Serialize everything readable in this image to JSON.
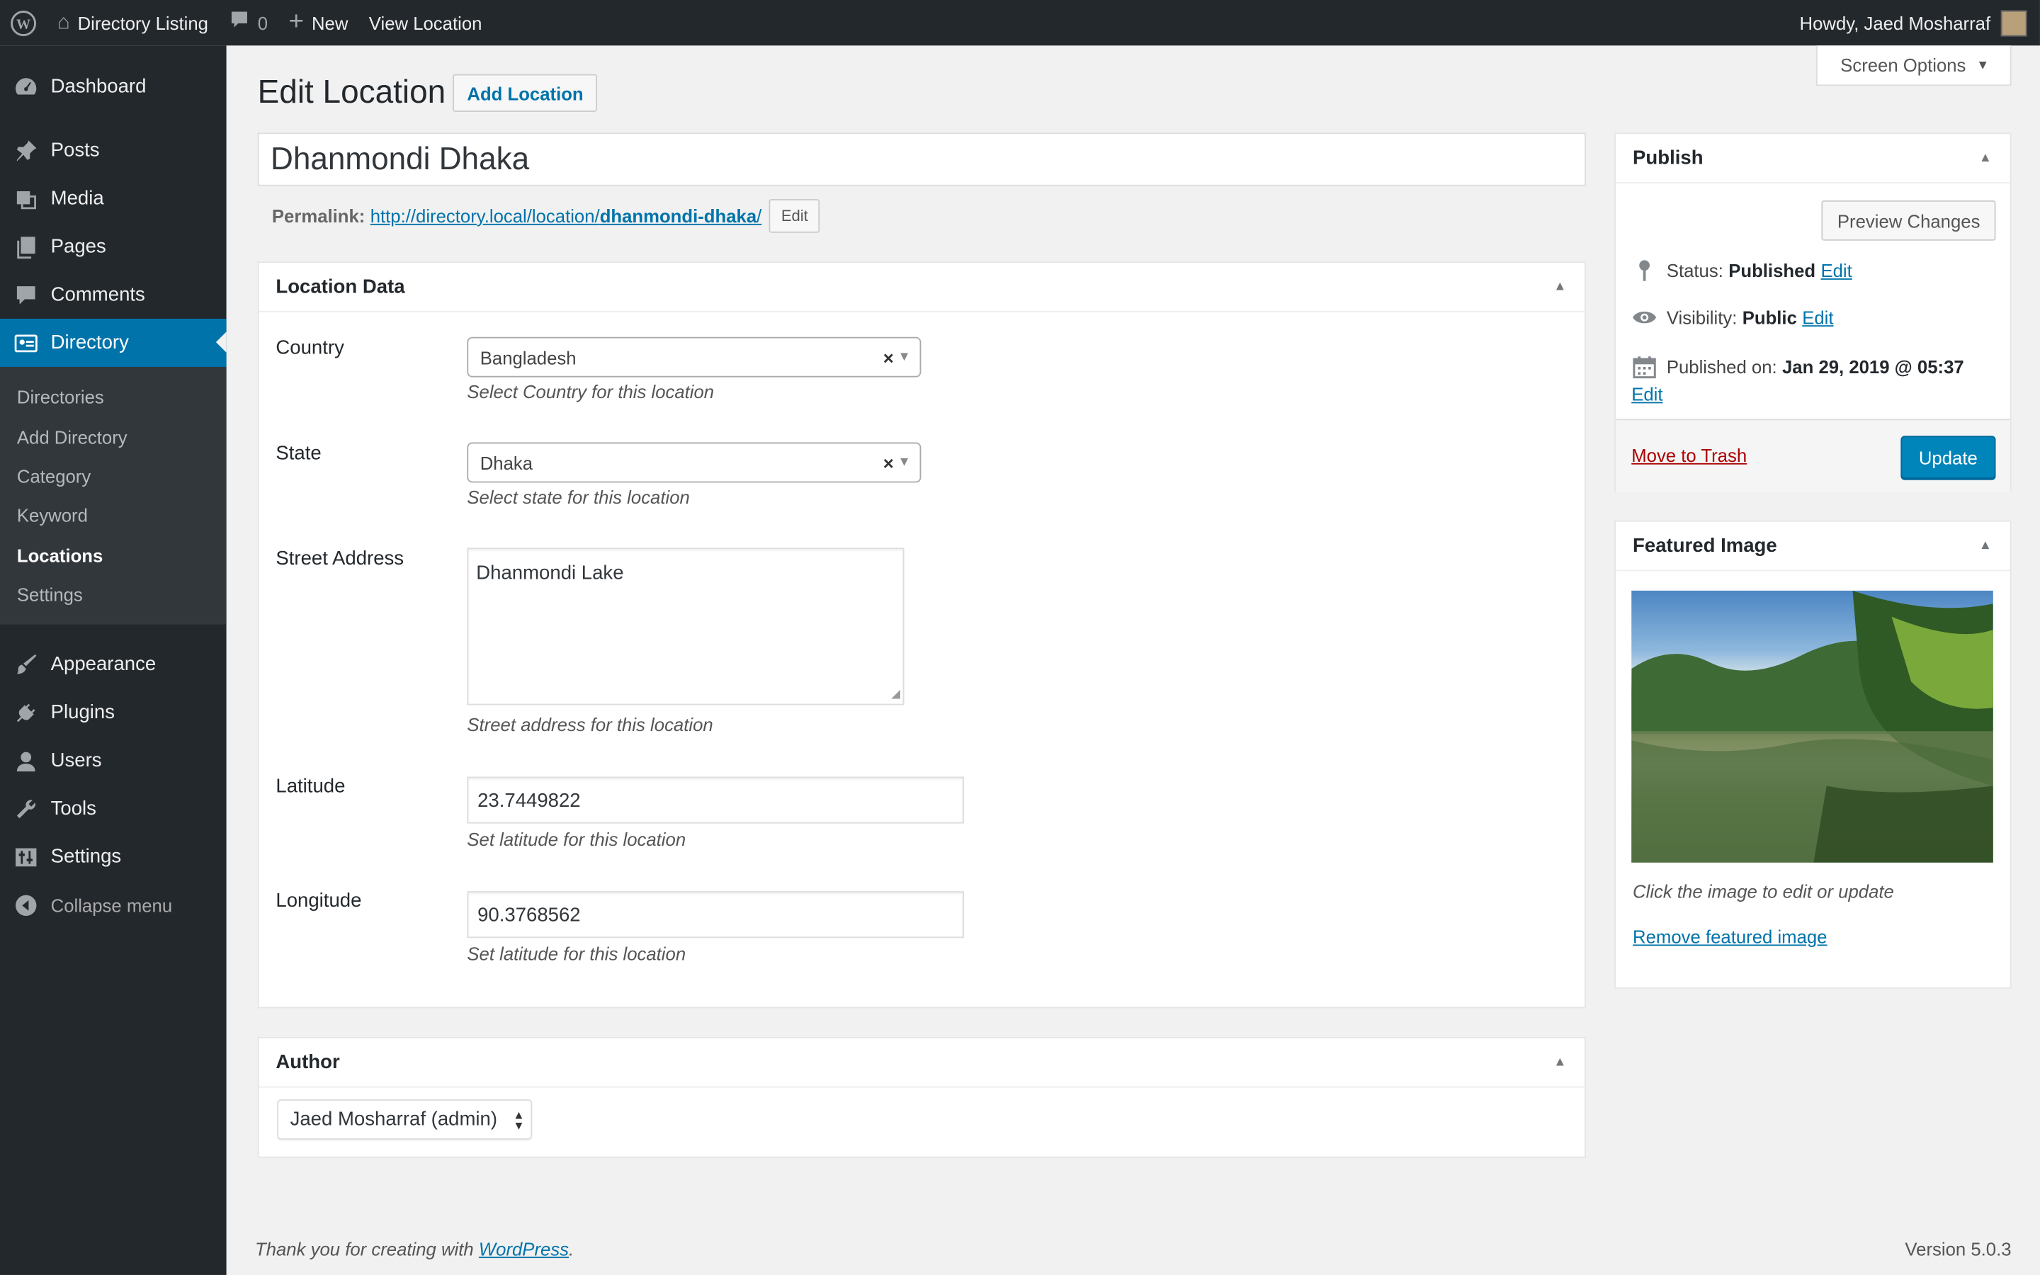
{
  "adminbar": {
    "site_name": "Directory Listing",
    "comments_count": "0",
    "new_label": "New",
    "view_label": "View Location",
    "howdy": "Howdy, Jaed Mosharraf"
  },
  "sidebar": {
    "dashboard": "Dashboard",
    "posts": "Posts",
    "media": "Media",
    "pages": "Pages",
    "comments": "Comments",
    "directory": "Directory",
    "sub": [
      "Directories",
      "Add Directory",
      "Category",
      "Keyword",
      "Locations",
      "Settings"
    ],
    "appearance": "Appearance",
    "plugins": "Plugins",
    "users": "Users",
    "tools": "Tools",
    "settings": "Settings",
    "collapse": "Collapse menu"
  },
  "header": {
    "screen_options": "Screen Options",
    "title": "Edit Location",
    "add_button": "Add Location"
  },
  "post": {
    "title": "Dhanmondi Dhaka",
    "permalink_label": "Permalink:",
    "permalink_base": "http://directory.local/location/",
    "permalink_slug": "dhanmondi-dhaka",
    "permalink_trail": "/",
    "edit_label": "Edit"
  },
  "location_box": {
    "heading": "Location Data",
    "country_label": "Country",
    "country_value": "Bangladesh",
    "country_desc": "Select Country for this location",
    "state_label": "State",
    "state_value": "Dhaka",
    "state_desc": "Select state for this location",
    "street_label": "Street Address",
    "street_value": "Dhanmondi Lake",
    "street_desc": "Street address for this location",
    "lat_label": "Latitude",
    "lat_value": "23.7449822",
    "lat_desc": "Set latitude for this location",
    "lng_label": "Longitude",
    "lng_value": "90.3768562",
    "lng_desc": "Set latitude for this location",
    "clear_symbol": "×"
  },
  "author_box": {
    "heading": "Author",
    "value": "Jaed Mosharraf (admin)"
  },
  "publish_box": {
    "heading": "Publish",
    "preview": "Preview Changes",
    "status_label": "Status:",
    "status_value": "Published",
    "visibility_label": "Visibility:",
    "visibility_value": "Public",
    "published_label": "Published on:",
    "published_value": "Jan 29, 2019 @ 05:37",
    "edit": "Edit",
    "trash": "Move to Trash",
    "update": "Update"
  },
  "featured_box": {
    "heading": "Featured Image",
    "caption": "Click the image to edit or update",
    "remove": "Remove featured image"
  },
  "footer": {
    "thanks_prefix": "Thank you for creating with ",
    "wp_link": "WordPress",
    "thanks_suffix": ".",
    "version": "Version 5.0.3"
  },
  "colors": {
    "admin_dark": "#23282d",
    "accent": "#0073aa",
    "update_button": "#0085ba",
    "trash": "#aa0000"
  }
}
